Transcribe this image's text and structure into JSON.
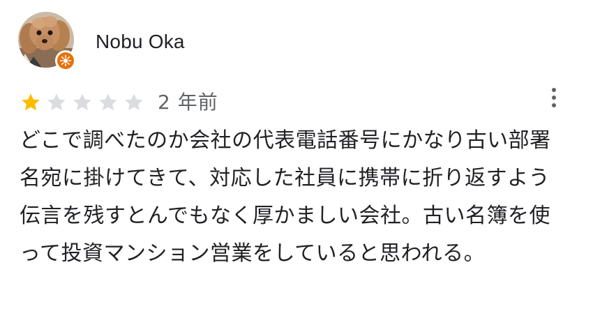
{
  "reviewer": {
    "name": "Nobu Oka",
    "avatar_icon": "dog-photo-avatar",
    "badge_icon": "local-guide-badge-icon",
    "badge_color": "#e8710a"
  },
  "rating": {
    "value": 1,
    "max": 5,
    "filled_color": "#fbbc04",
    "empty_color": "#dadce0"
  },
  "date": "2 年前",
  "menu_icon": "more-vert-icon",
  "review_text": "どこで調べたのか会社の代表電話番号にかなり古い部署名宛に掛けてきて、対応した社員に携帯に折り返すよう伝言を残すとんでもなく厚かましい会社。古い名簿を使って投資マンション営業をしていると思われる。"
}
